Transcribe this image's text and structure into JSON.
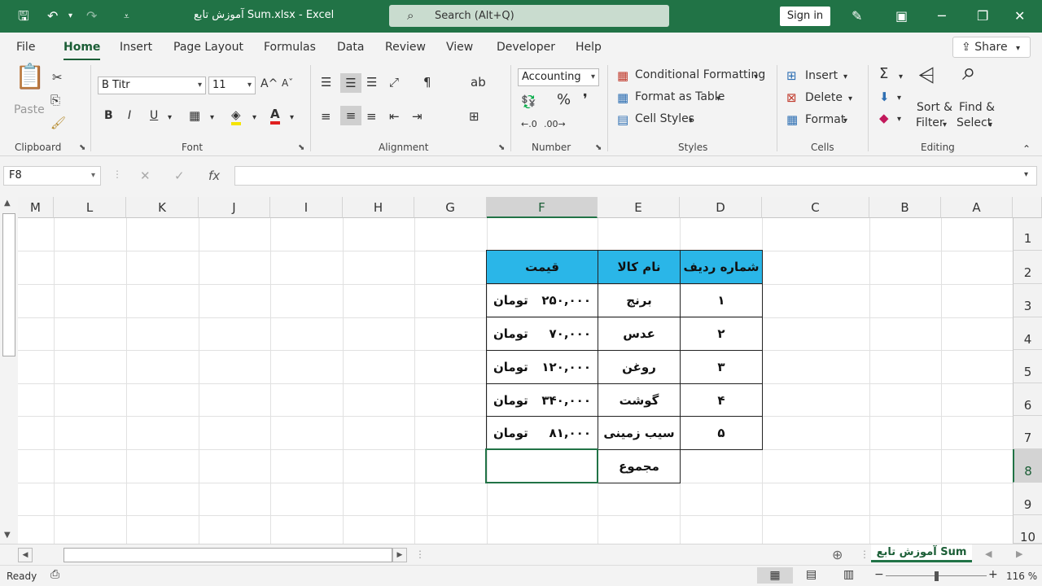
{
  "titlebar": {
    "doc_title": "آموزش تابع Sum.xlsx  -  Excel",
    "search_placeholder": "Search (Alt+Q)",
    "sign_in": "Sign in"
  },
  "menu": {
    "tabs": [
      "File",
      "Home",
      "Insert",
      "Page Layout",
      "Formulas",
      "Data",
      "Review",
      "View",
      "Developer",
      "Help"
    ],
    "active": "Home",
    "share": "Share"
  },
  "ribbon": {
    "clipboard": {
      "label": "Clipboard",
      "paste": "Paste"
    },
    "font": {
      "label": "Font",
      "family": "B Titr",
      "size": "11",
      "bold": "B",
      "italic": "I",
      "underline": "U",
      "grow": "A^",
      "shrink": "Aˇ"
    },
    "alignment": {
      "label": "Alignment"
    },
    "number": {
      "label": "Number",
      "format": "Accounting"
    },
    "styles": {
      "label": "Styles",
      "conditional": "Conditional Formatting",
      "format_table": "Format as Table",
      "cell_styles": "Cell Styles"
    },
    "cells": {
      "label": "Cells",
      "insert": "Insert",
      "delete": "Delete",
      "format": "Format"
    },
    "editing": {
      "label": "Editing",
      "sort_filter_1": "Sort &",
      "sort_filter_2": "Filter",
      "find_select_1": "Find &",
      "find_select_2": "Select"
    }
  },
  "formula_bar": {
    "name_box": "F8",
    "fx": "fx",
    "value": ""
  },
  "grid": {
    "columns": [
      "M",
      "L",
      "K",
      "J",
      "I",
      "H",
      "G",
      "F",
      "E",
      "D",
      "C",
      "B",
      "A"
    ],
    "rows": [
      "1",
      "2",
      "3",
      "4",
      "5",
      "6",
      "7",
      "8",
      "9",
      "10"
    ],
    "selected_column": "F",
    "selected_row": "8"
  },
  "table": {
    "headers": {
      "price": "قیمت",
      "item": "نام کالا",
      "row": "شماره ردیف"
    },
    "currency": "تومان",
    "rows": [
      {
        "no": "۱",
        "item": "برنج",
        "amount": "۲۵۰,۰۰۰"
      },
      {
        "no": "۲",
        "item": "عدس",
        "amount": "۷۰,۰۰۰"
      },
      {
        "no": "۳",
        "item": "روغن",
        "amount": "۱۲۰,۰۰۰"
      },
      {
        "no": "۴",
        "item": "گوشت",
        "amount": "۳۴۰,۰۰۰"
      },
      {
        "no": "۵",
        "item": "سیب زمینی",
        "amount": "۸۱,۰۰۰"
      }
    ],
    "total_label": "مجموع"
  },
  "sheet": {
    "tab_name": "آموزش تابع Sum"
  },
  "status": {
    "ready": "Ready",
    "zoom": "116 %"
  }
}
